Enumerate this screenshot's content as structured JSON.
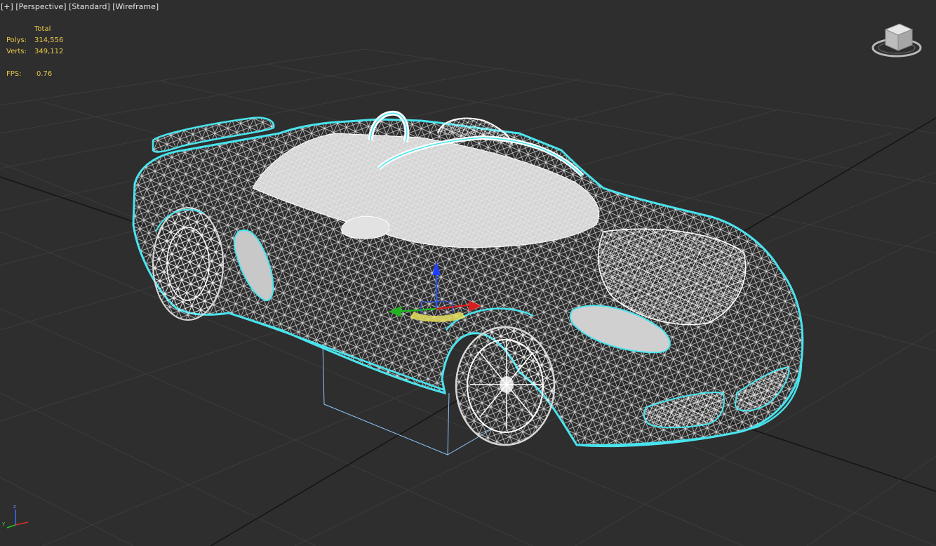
{
  "viewport": {
    "labels": {
      "plus": "[+]",
      "view": "[Perspective]",
      "shading_mode": "[Standard]",
      "display": "[Wireframe]"
    },
    "stats": {
      "header": "Total",
      "polys_label": "Polys:",
      "polys_value": "314,556",
      "verts_label": "Verts:",
      "verts_value": "349,112",
      "fps_label": "FPS:",
      "fps_value": "0.76"
    },
    "viewcube_icon": "viewcube-icon",
    "axis_tripod_icon": "axis-tripod-icon",
    "colors": {
      "background": "#2e2e2e",
      "grid": "#3c3c3c",
      "grid_major": "#141414",
      "wireframe": "#f2f2f2",
      "selection_outline": "#49e4ee",
      "stats_text": "#e8c84a"
    }
  }
}
